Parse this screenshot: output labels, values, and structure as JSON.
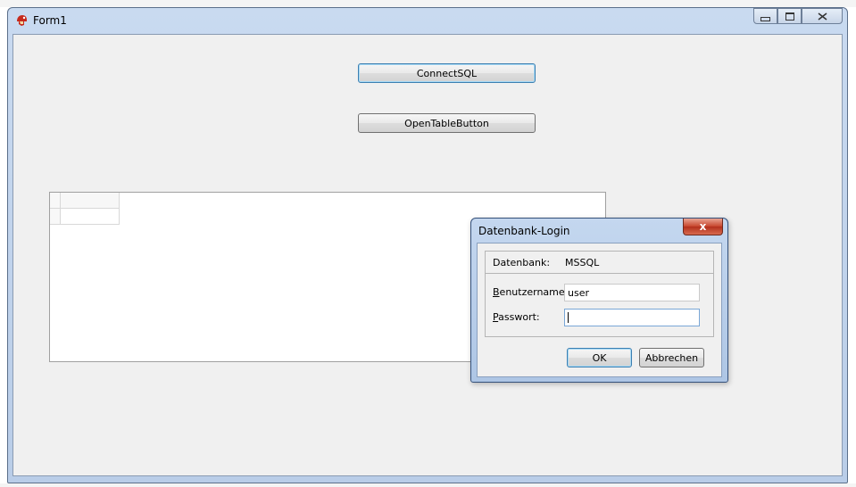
{
  "main_window": {
    "title": "Form1",
    "buttons": {
      "connect_sql": "ConnectSQL",
      "open_table": "OpenTableButton"
    }
  },
  "login_dialog": {
    "title": "Datenbank-Login",
    "close_glyph": "x",
    "database_label": "Datenbank:",
    "database_value": "MSSQL",
    "username_label_accel": "B",
    "username_label_rest": "enutzername:",
    "username_value": "user",
    "password_label_accel": "P",
    "password_label_rest": "asswort:",
    "password_value": "",
    "ok_label": "OK",
    "cancel_label": "Abbrechen"
  },
  "icons": {
    "app": "delphi-helmet-icon",
    "minimize": "minimize-icon",
    "maximize": "maximize-icon",
    "close": "close-icon"
  }
}
